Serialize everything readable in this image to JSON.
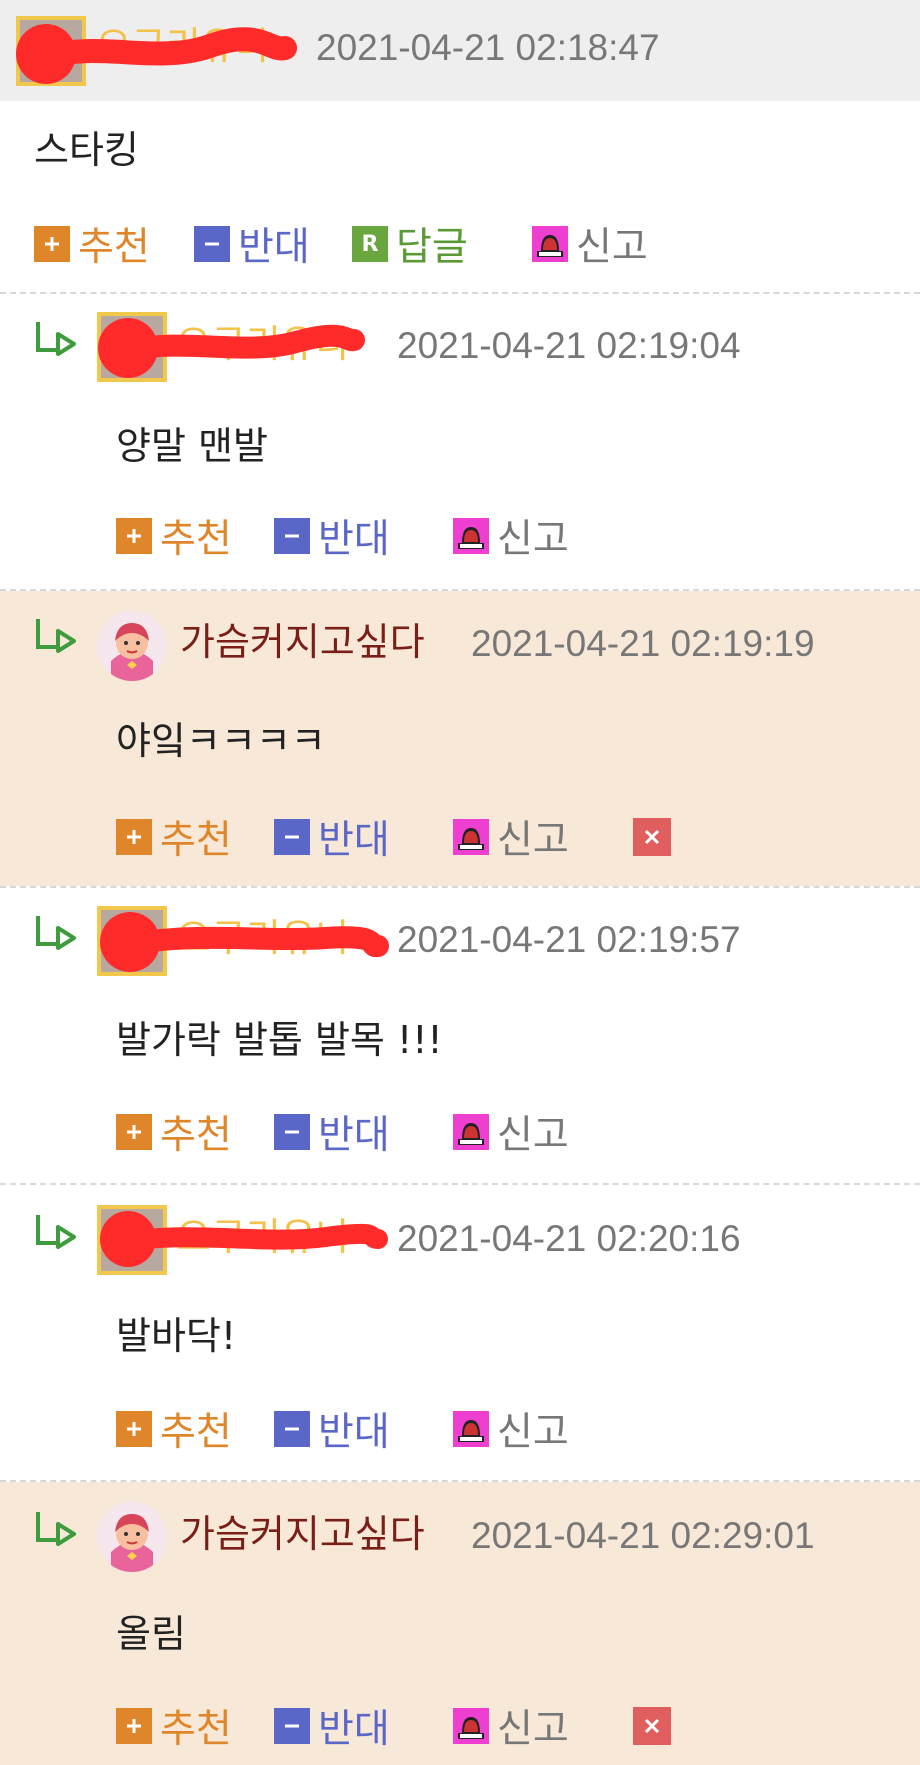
{
  "colors": {
    "recommend": "#e0862a",
    "oppose": "#5a66c8",
    "reply": "#5a9a34",
    "report_icon": "#ee3fd0",
    "delete": "#e05e5e",
    "highlight_bg": "#f7e8d7",
    "top_header_bg": "#eeeeee"
  },
  "actions": {
    "recommend": "추천",
    "oppose": "반대",
    "reply": "답글",
    "report": "신고"
  },
  "comments": [
    {
      "type": "top",
      "nickname": "오구리유나",
      "date": "2021-04-21 02:18:47",
      "text": "스타킹",
      "redacted": true
    },
    {
      "type": "reply",
      "nickname": "오구리유나",
      "date": "2021-04-21 02:19:04",
      "text": "양말 맨발",
      "redacted": true
    },
    {
      "type": "reply",
      "nickname": "가슴커지고싶다",
      "date": "2021-04-21 02:19:19",
      "text": "야잌ㅋㅋㅋㅋ",
      "redacted": false
    },
    {
      "type": "reply",
      "nickname": "오구리유나",
      "date": "2021-04-21 02:19:57",
      "text": "발가락 발톱 발목 !!!",
      "redacted": true
    },
    {
      "type": "reply",
      "nickname": "오구리유나",
      "date": "2021-04-21 02:20:16",
      "text": "발바닥!",
      "redacted": true
    },
    {
      "type": "reply",
      "nickname": "가슴커지고싶다",
      "date": "2021-04-21 02:29:01",
      "text": "올림",
      "redacted": false
    }
  ]
}
